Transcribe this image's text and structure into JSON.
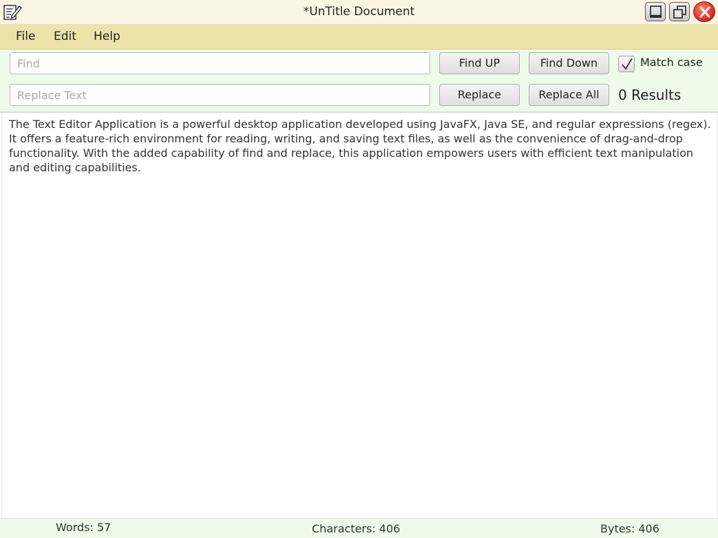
{
  "window": {
    "title": "*UnTitle Document",
    "icons": {
      "app": "notepad-pencil-icon",
      "minimize": "minimize-icon",
      "restore": "restore-icon",
      "close": "close-icon"
    }
  },
  "menu": {
    "items": [
      "File",
      "Edit",
      "Help"
    ]
  },
  "find_bar": {
    "find_placeholder": "Find",
    "find_value": "",
    "replace_placeholder": "Replace Text",
    "replace_value": "",
    "find_up_label": "Find UP",
    "find_down_label": "Find Down",
    "replace_label": "Replace",
    "replace_all_label": "Replace All",
    "match_case_label": "Match case",
    "match_case_checked": true,
    "results_text": "0 Results"
  },
  "editor": {
    "content": "The Text Editor Application is a powerful desktop application developed using JavaFX, Java SE, and regular expressions (regex). It offers a feature-rich environment for reading, writing, and saving text files, as well as the convenience of drag-and-drop functionality. With the added capability of find and replace, this application empowers users with efficient text manipulation and editing capabilities."
  },
  "status": {
    "words": "Words: 57",
    "characters": "Characters: 406",
    "bytes": "Bytes: 406"
  },
  "colors": {
    "titlebar": "#fbf5e6",
    "menubar": "#ede3a9",
    "toolbar": "#eefbea",
    "statusbar": "#eefbea",
    "close_button": "#d9261a"
  }
}
